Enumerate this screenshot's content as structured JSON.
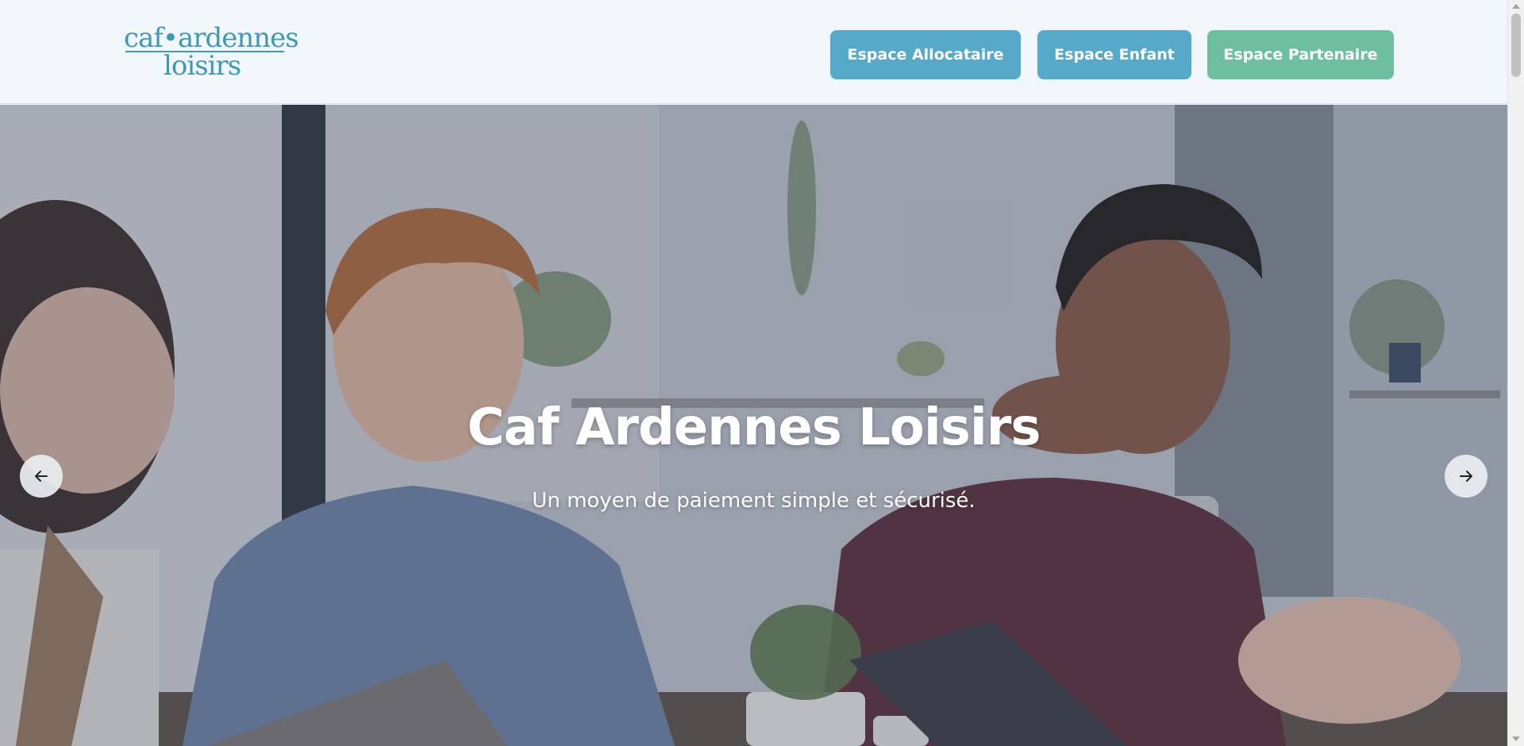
{
  "logo": {
    "line1": "caf•ardennes",
    "line2": "loisirs"
  },
  "nav": {
    "allocataire": "Espace Allocataire",
    "enfant": "Espace Enfant",
    "partenaire": "Espace Partenaire"
  },
  "hero": {
    "title": "Caf Ardennes Loisirs",
    "subtitle": "Un moyen de paiement simple et sécurisé."
  },
  "carousel": {
    "prev_icon": "arrow-left-icon",
    "next_icon": "arrow-right-icon"
  },
  "colors": {
    "brand_blue": "#57a9ca",
    "brand_green": "#6dbfa0",
    "logo_blue": "#3f98b6",
    "header_bg": "#f0f6fa"
  }
}
